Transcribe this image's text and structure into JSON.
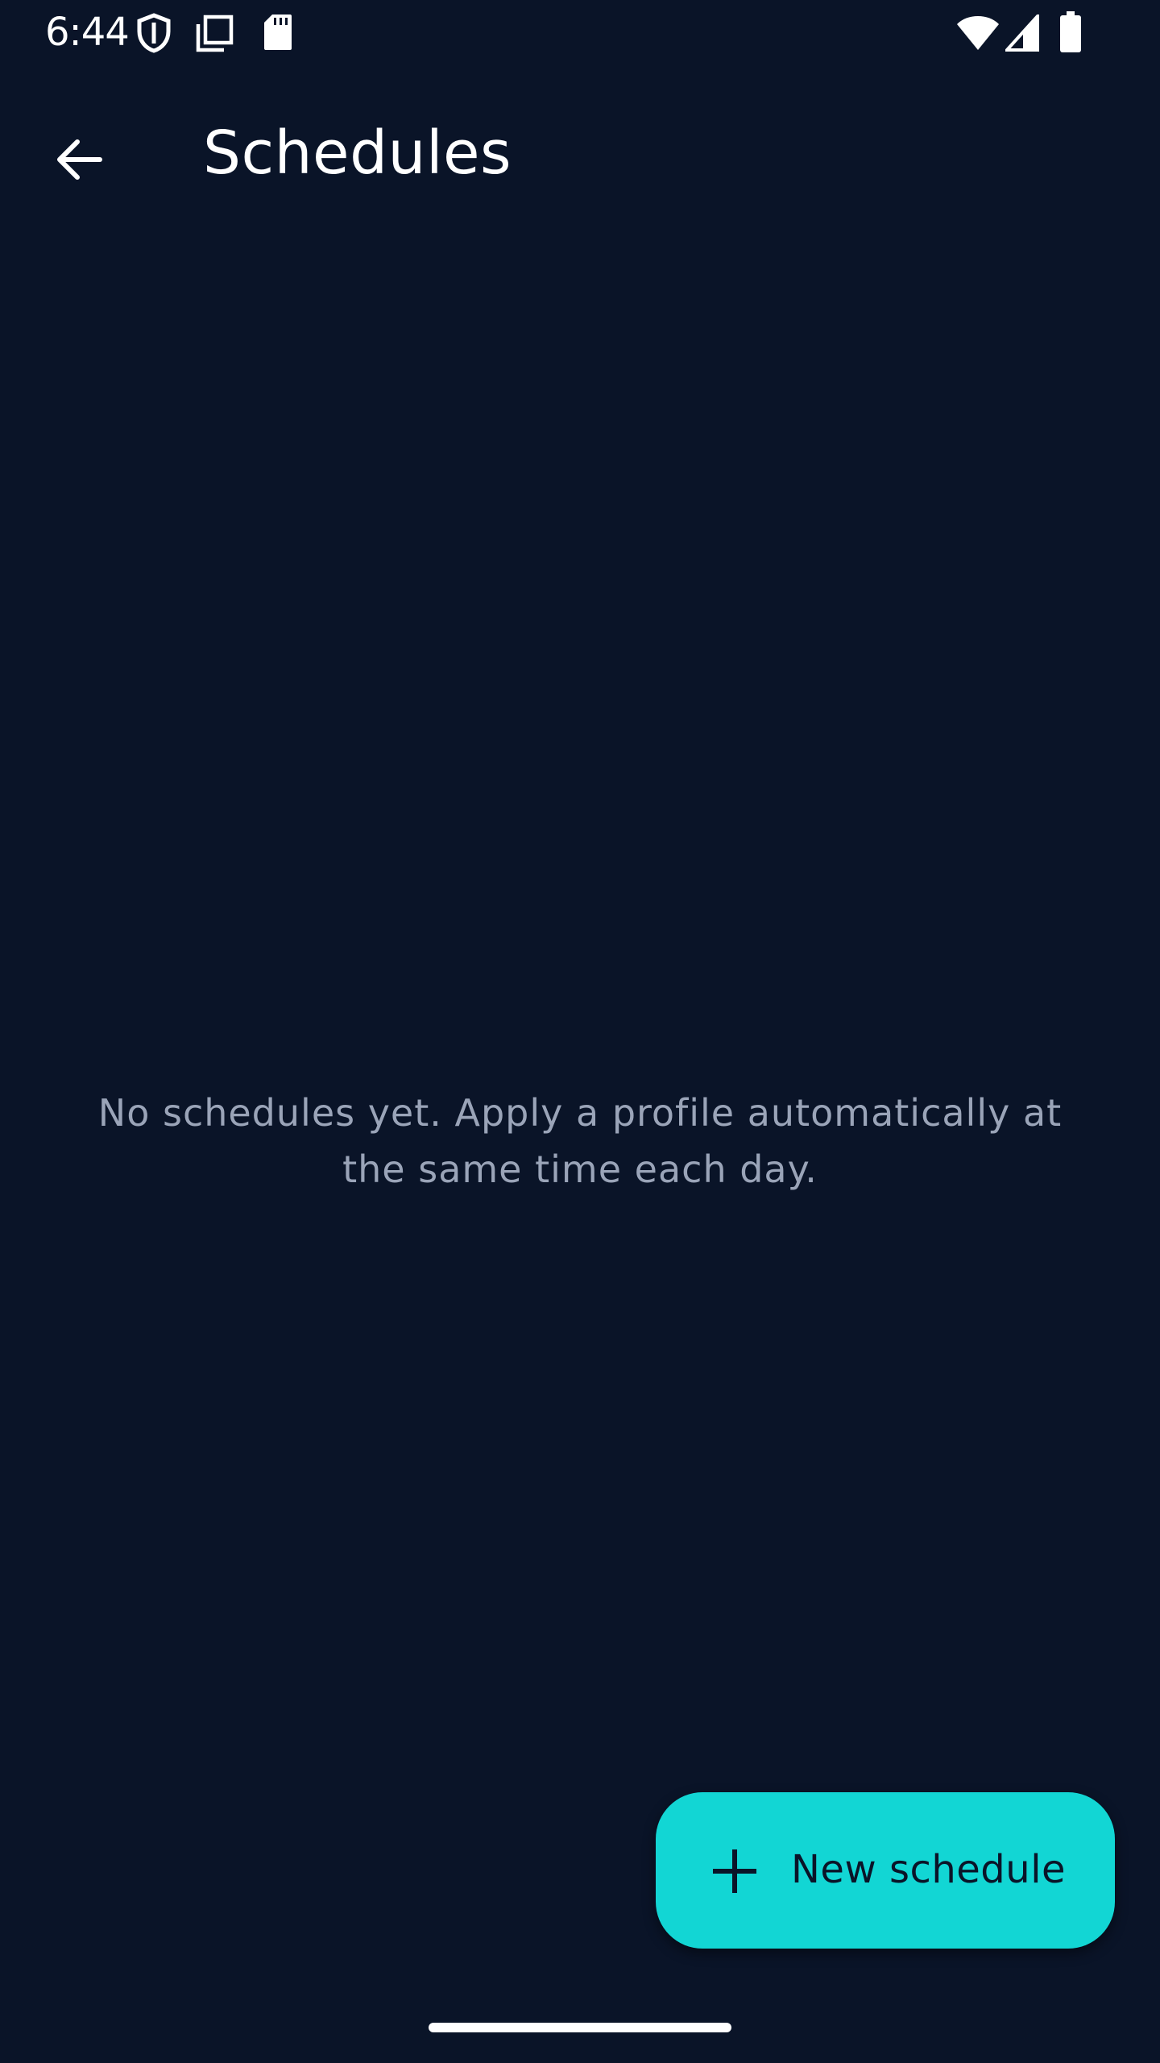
{
  "status_bar": {
    "time": "6:44",
    "icons_left": [
      "shield-icon",
      "copy-icon",
      "sd-card-icon"
    ],
    "icons_right": [
      "wifi-icon",
      "signal-icon",
      "battery-icon"
    ]
  },
  "app_bar": {
    "back_icon": "arrow-back-icon",
    "title": "Schedules"
  },
  "main": {
    "empty_message": "No schedules yet. Apply a profile automatically at the same time each day."
  },
  "fab": {
    "icon": "plus-icon",
    "label": "New schedule"
  },
  "colors": {
    "background": "#0a1428",
    "accent": "#12d6d4",
    "muted_text": "#9aa4b8"
  }
}
